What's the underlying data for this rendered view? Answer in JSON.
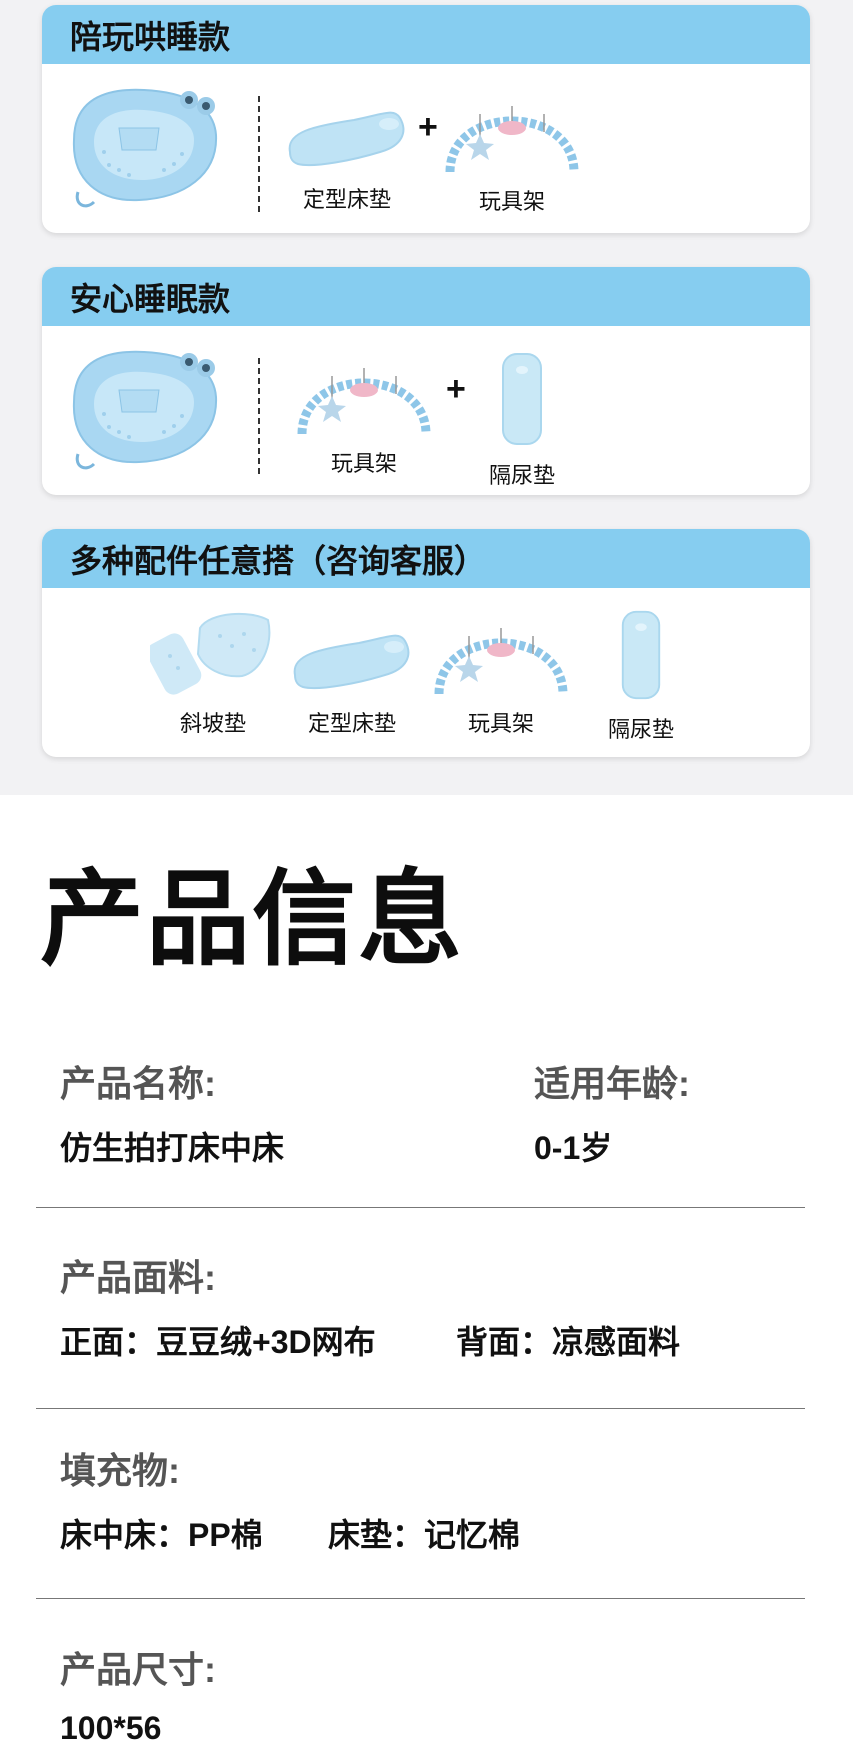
{
  "colors": {
    "header_blue": "#86cdf0",
    "product_blue": "#bfe3f5",
    "top_bg": "#f2f2f4"
  },
  "cards": [
    {
      "title": "陪玩哄睡款",
      "items": [
        {
          "icon": "bassinet-icon",
          "label": ""
        },
        {
          "icon": "mattress-icon",
          "label": "定型床垫"
        },
        {
          "icon": "toy-arch-icon",
          "label": "玩具架"
        }
      ],
      "plus": "+"
    },
    {
      "title": "安心睡眠款",
      "items": [
        {
          "icon": "bassinet-icon",
          "label": ""
        },
        {
          "icon": "toy-arch-icon",
          "label": "玩具架"
        },
        {
          "icon": "diaper-pad-icon",
          "label": "隔尿垫"
        }
      ],
      "plus": "+"
    },
    {
      "title": "多种配件任意搭（咨询客服）",
      "items": [
        {
          "icon": "wedge-pad-icon",
          "label": "斜坡垫"
        },
        {
          "icon": "mattress-icon",
          "label": "定型床垫"
        },
        {
          "icon": "toy-arch-icon",
          "label": "玩具架"
        },
        {
          "icon": "diaper-pad-icon",
          "label": "隔尿垫"
        }
      ]
    }
  ],
  "product_info": {
    "title": "产品信息",
    "name_label": "产品名称:",
    "name_value": "仿生拍打床中床",
    "age_label": "适用年龄:",
    "age_value": "0-1岁",
    "fabric_label": "产品面料:",
    "fabric_front": "正面：豆豆绒+3D网布",
    "fabric_back": "背面：凉感面料",
    "filling_label": "填充物:",
    "filling_main": "床中床：PP棉",
    "filling_mattress": "床垫：记忆棉",
    "size_label": "产品尺寸:",
    "size_value": "100*56"
  }
}
